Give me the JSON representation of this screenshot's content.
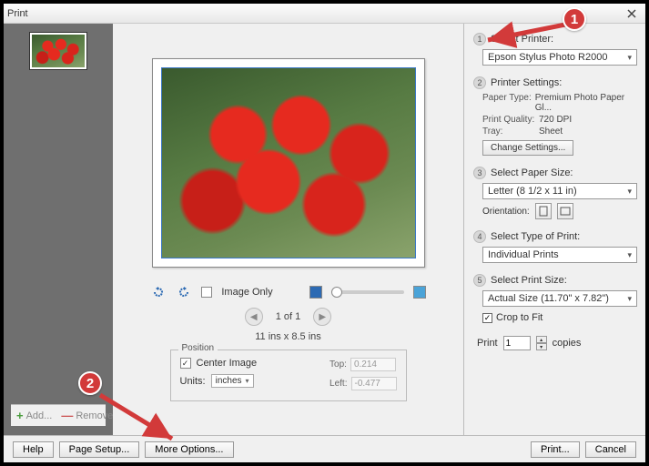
{
  "window": {
    "title": "Print"
  },
  "thumb": {
    "add": "Add...",
    "remove": "Remove"
  },
  "center": {
    "image_only": "Image Only",
    "page_indicator": "1 of 1",
    "dimensions": "11 ins x 8.5 ins",
    "position_legend": "Position",
    "center_image": "Center Image",
    "units_label": "Units:",
    "units_value": "inches",
    "top_label": "Top:",
    "top_value": "0.214",
    "left_label": "Left:",
    "left_value": "-0.477"
  },
  "right": {
    "step1": {
      "num": "1",
      "title": "Select Printer:",
      "value": "Epson Stylus Photo R2000"
    },
    "step2": {
      "num": "2",
      "title": "Printer Settings:",
      "paper_type_k": "Paper Type:",
      "paper_type_v": "Premium Photo Paper Gl...",
      "quality_k": "Print Quality:",
      "quality_v": "720 DPI",
      "tray_k": "Tray:",
      "tray_v": "Sheet",
      "change_btn": "Change Settings..."
    },
    "step3": {
      "num": "3",
      "title": "Select Paper Size:",
      "value": "Letter (8 1/2 x 11 in)",
      "orient_label": "Orientation:"
    },
    "step4": {
      "num": "4",
      "title": "Select Type of Print:",
      "value": "Individual Prints"
    },
    "step5": {
      "num": "5",
      "title": "Select Print Size:",
      "value": "Actual Size (11.70\" x 7.82\")",
      "crop": "Crop to Fit"
    },
    "copies": {
      "label": "Print",
      "value": "1",
      "suffix": "copies"
    }
  },
  "footer": {
    "help": "Help",
    "page_setup": "Page Setup...",
    "more_options": "More Options...",
    "print": "Print...",
    "cancel": "Cancel"
  },
  "annotations": {
    "one": "1",
    "two": "2"
  }
}
